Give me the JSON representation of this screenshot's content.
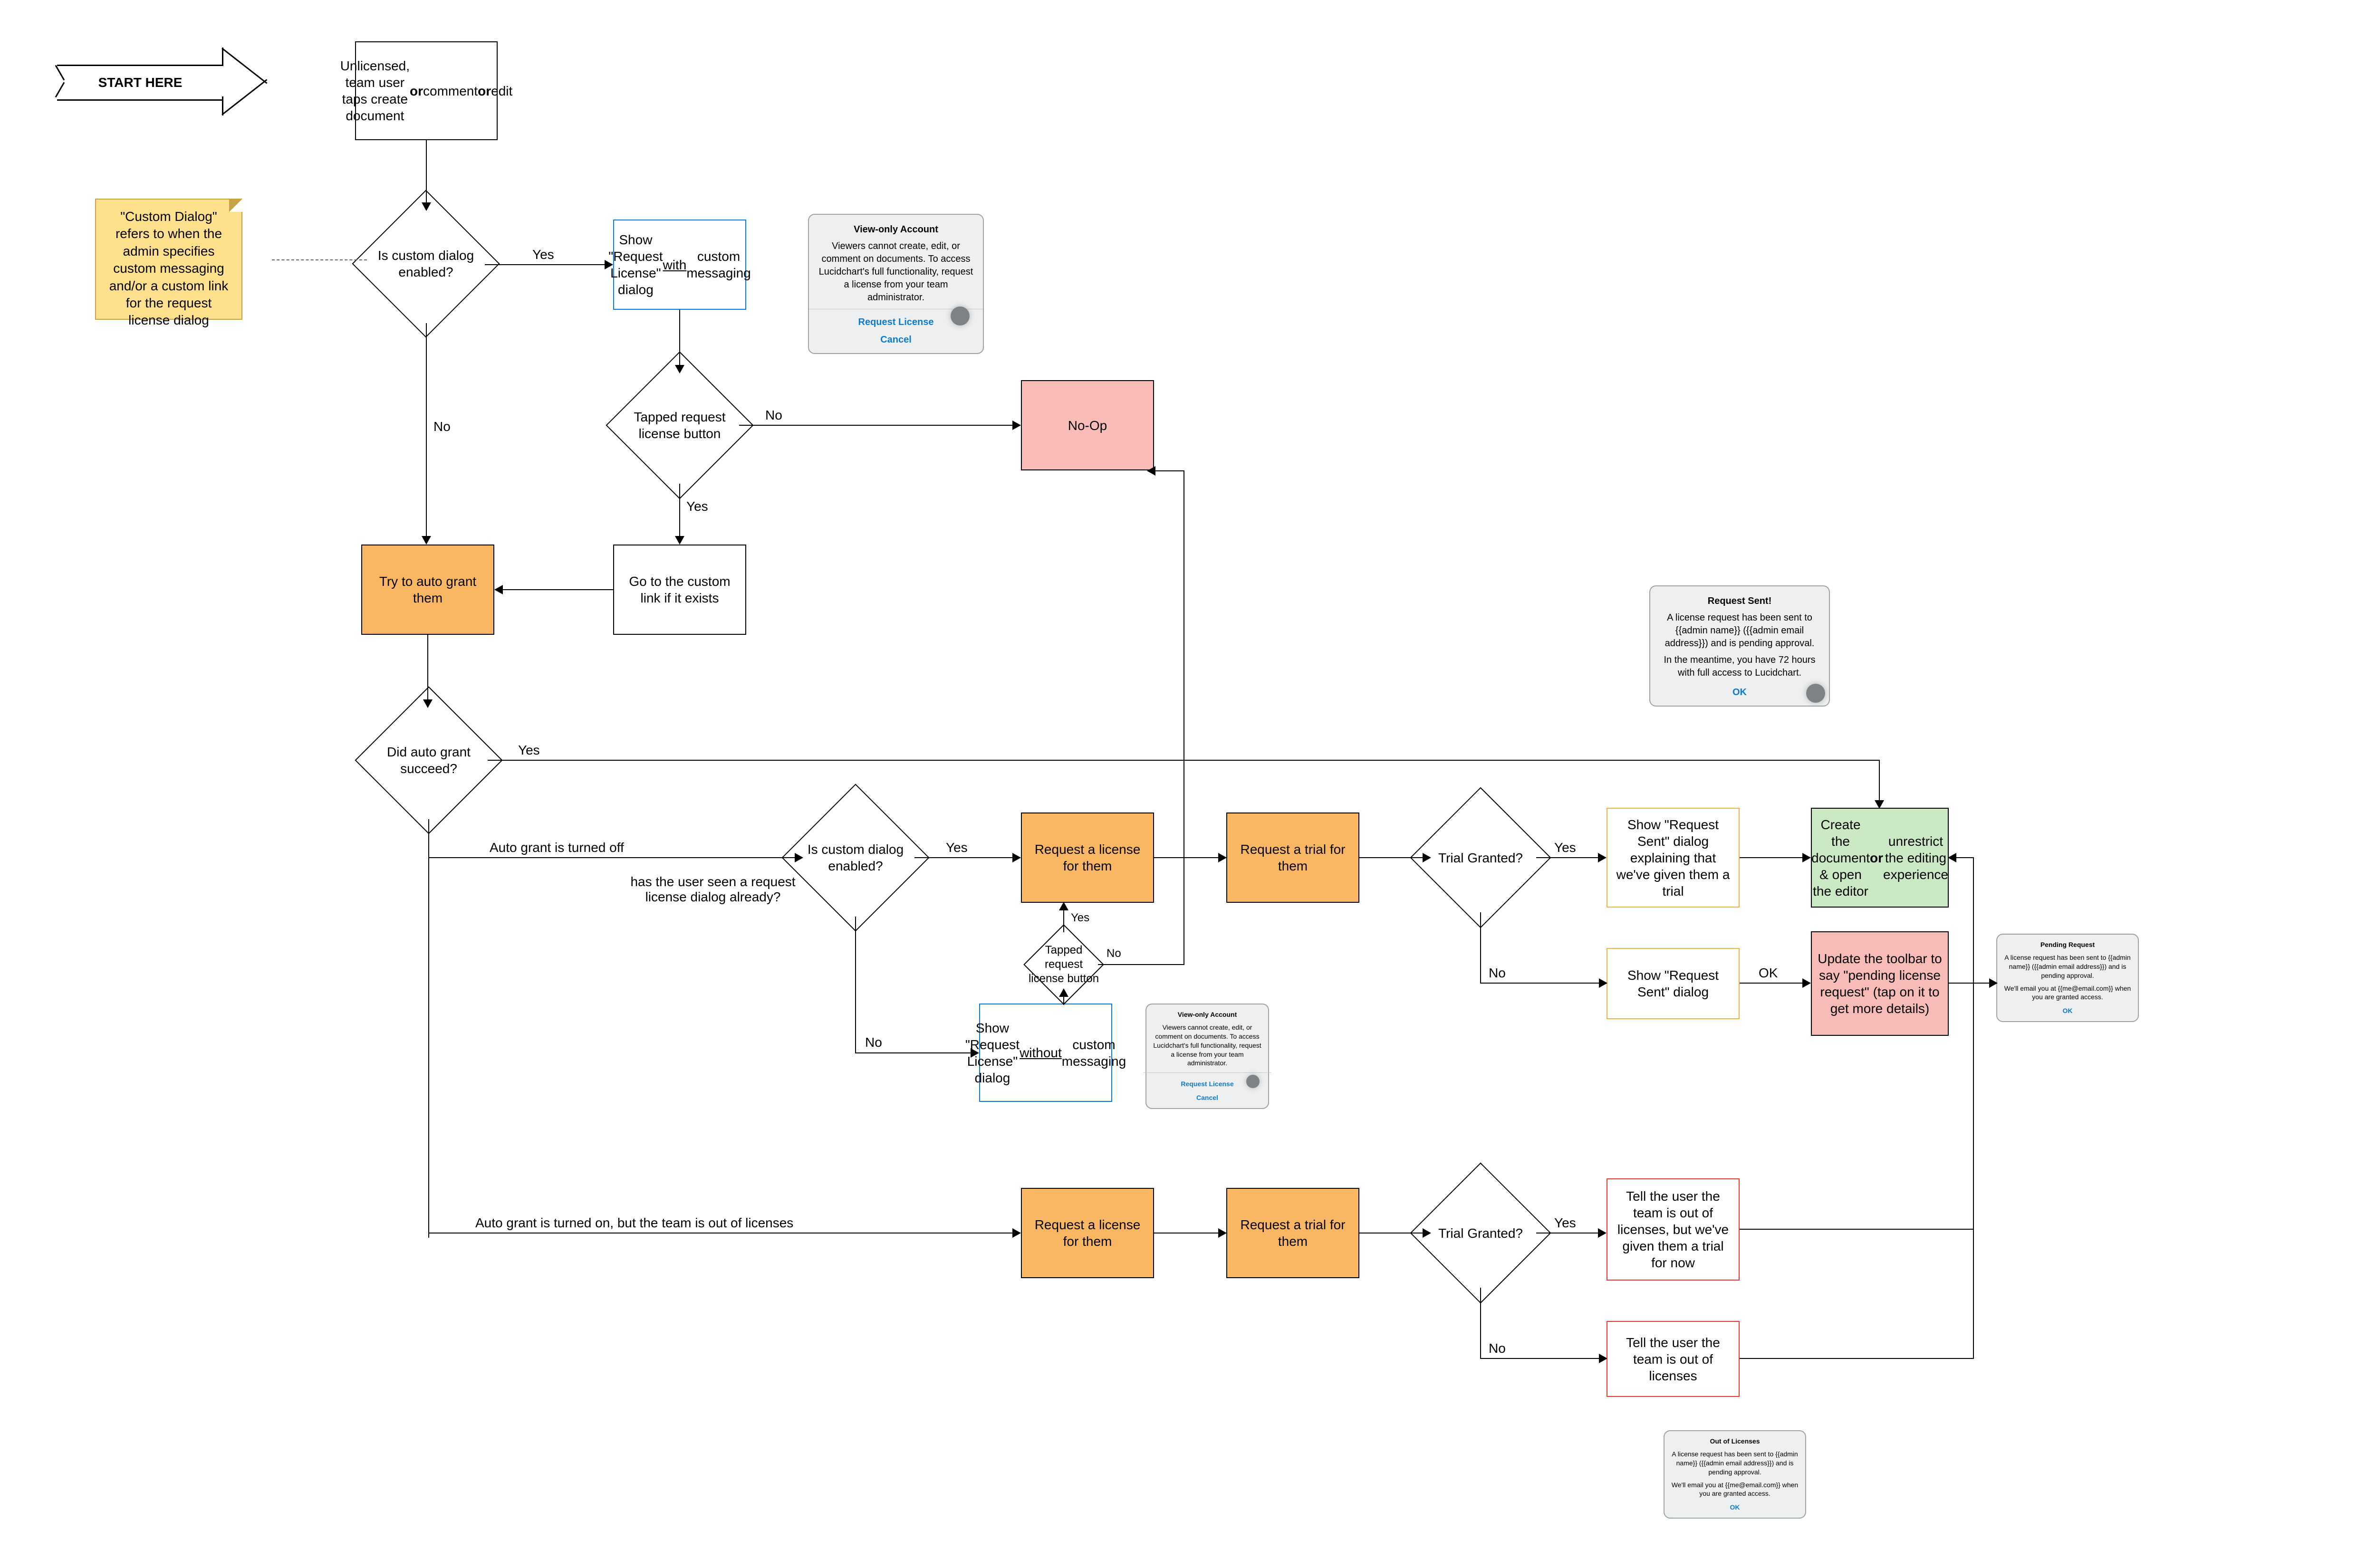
{
  "start_arrow": "START HERE",
  "note_custom_dialog": "\"Custom Dialog\" refers to when the admin specifies custom messaging and/or a custom link for the request license dialog",
  "nodes": {
    "n_start": "Unlicensed, team user taps create document <b>or</b> comment <b>or</b> edit",
    "d_custom1": "Is custom dialog enabled?",
    "n_show_req_with": "Show \"Request License\" dialog <u>with</u> custom messaging",
    "d_tap_req_1": "Tapped request license button",
    "n_noop": "No-Op",
    "n_try_auto": "Try to auto grant them",
    "n_goto_custom": "Go to the custom link if it exists",
    "d_auto_succeed": "Did auto grant succeed?",
    "d_custom2": "Is custom dialog enabled?",
    "n_req_license_a": "Request a license for them",
    "n_req_trial_a": "Request a trial for them",
    "d_trial_a": "Trial Granted?",
    "n_show_sent_trial": "Show \"Request Sent\" dialog explaining that we've given them a trial",
    "n_show_sent": "Show \"Request Sent\" dialog",
    "n_create_doc": "Create the document & open the editor <b>or</b> unrestrict the editing experience",
    "n_update_toolbar": "Update the toolbar to say \"pending license request\" (tap on it to get more details)",
    "n_show_req_without": "Show \"Request License\" dialog <u>without</u> custom messaging",
    "d_tap_req_2": "Tapped request license button",
    "n_req_license_b": "Request a license for them",
    "n_req_trial_b": "Request a trial for them",
    "d_trial_b": "Trial Granted?",
    "n_out_trial": "Tell the user the team is out of licenses, but we've given them a trial for now",
    "n_out_no": "Tell the user the team is out of licenses"
  },
  "labels": {
    "yes": "Yes",
    "no": "No",
    "ok": "OK",
    "auto_off": "Auto grant is turned off",
    "has_seen": "has the user seen a request license dialog already?",
    "auto_on_out": "Auto grant is turned on, but the team is out of licenses"
  },
  "dialogs": {
    "viewonly": {
      "title": "View-only Account",
      "body": "Viewers cannot create, edit, or comment on documents. To access Lucidchart's full functionality, request a license from your team administrator.",
      "cta1": "Request License",
      "cta2": "Cancel"
    },
    "request_sent": {
      "title": "Request Sent!",
      "body1": "A license request has been sent to {{admin name}} ({{admin email address}}) and is pending approval.",
      "body2": "In the meantime, you have 72 hours with full access to Lucidchart.",
      "ok": "OK"
    },
    "pending": {
      "title": "Pending Request",
      "body1": "A license request has been sent to {{admin name}} ({{admin email address}}) and is pending approval.",
      "body2": "We'll email you at {{me@email.com}} when you are granted access.",
      "ok": "OK"
    },
    "out": {
      "title": "Out of Licenses",
      "body1": "A license request has been sent to {{admin name}} ({{admin email address}}) and is pending approval.",
      "body2": "We'll email you at {{me@email.com}} when you are granted access.",
      "ok": "OK"
    }
  }
}
